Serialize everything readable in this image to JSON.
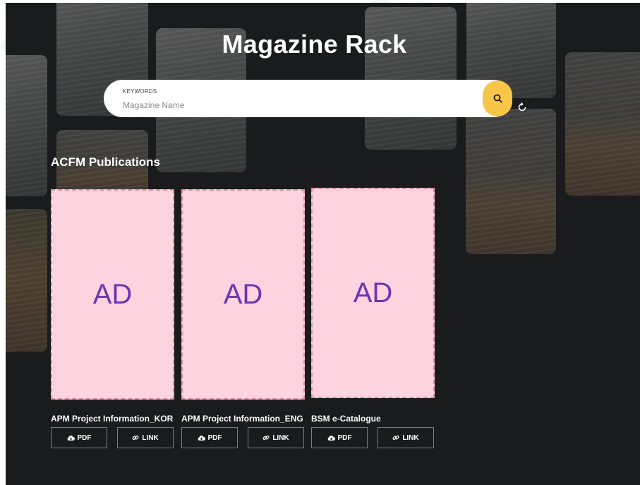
{
  "page": {
    "title": "Magazine Rack"
  },
  "search": {
    "caption": "KEYWORDS",
    "placeholder": "Magazine Name",
    "value": "",
    "button_icon": "search-icon",
    "reset_icon": "refresh-icon"
  },
  "section": {
    "title": "ACFM Publications"
  },
  "publications": [
    {
      "ad_text": "AD",
      "title": "APM Project Information_KOR",
      "pdf_label": "PDF",
      "link_label": "LINK"
    },
    {
      "ad_text": "AD",
      "title": "APM Project Information_ENG",
      "pdf_label": "PDF",
      "link_label": "LINK"
    },
    {
      "ad_text": "AD",
      "title": "BSM e-Catalogue",
      "pdf_label": "PDF",
      "link_label": "LINK"
    }
  ],
  "icons": {
    "pdf": "cloud-download-icon",
    "link": "link-icon"
  },
  "colors": {
    "background": "#1a1b1d",
    "search_button": "#f7c548",
    "ad_fill": "#fcd3df",
    "ad_border": "#de8f9f",
    "ad_text": "#6b36b1"
  }
}
